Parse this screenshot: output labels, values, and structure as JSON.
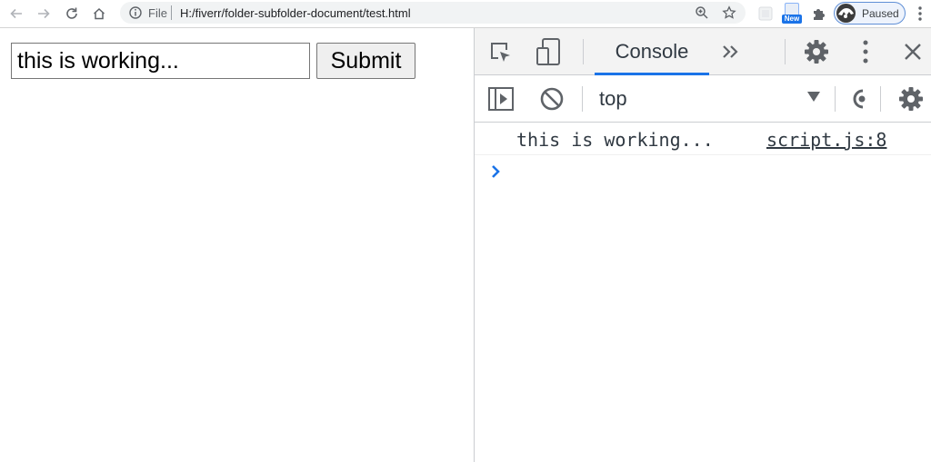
{
  "browser": {
    "url_scheme": "File",
    "url": "H:/fiverr/folder-subfolder-document/test.html",
    "extension_badge": "New",
    "profile_status": "Paused",
    "accent_color": "#1a73e8"
  },
  "page": {
    "input_value": "this is working...",
    "submit_label": "Submit"
  },
  "devtools": {
    "active_tab": "Console",
    "context": "top",
    "log": [
      {
        "message": "this is working...",
        "source": "script.js:8"
      }
    ]
  },
  "icons": [
    "back-icon",
    "forward-icon",
    "reload-icon",
    "home-icon",
    "info-icon",
    "zoom-icon",
    "star-icon",
    "extension-icon",
    "puzzle-icon",
    "menu-dots-icon",
    "inspect-icon",
    "device-toolbar-icon",
    "more-tabs-icon",
    "settings-icon",
    "close-icon",
    "sidebar-toggle-icon",
    "clear-console-icon",
    "eye-icon",
    "prompt-chevron-icon"
  ]
}
